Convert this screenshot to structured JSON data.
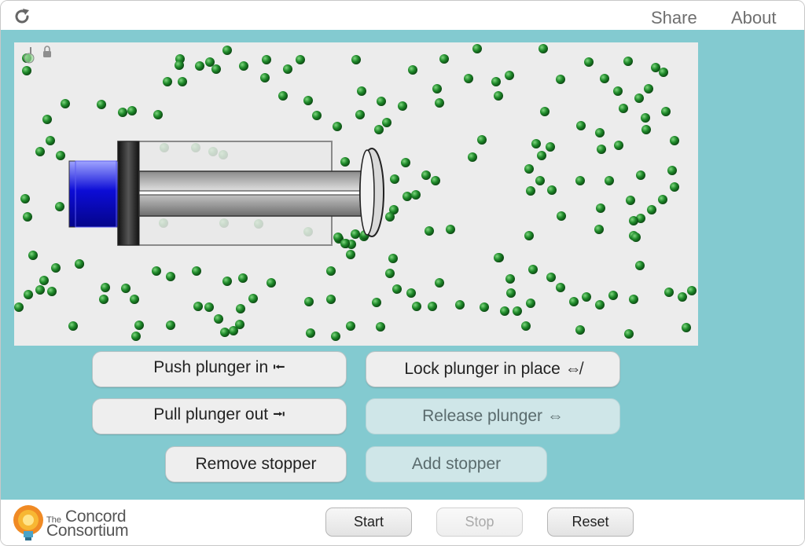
{
  "header": {
    "reload_icon": "reload-icon",
    "share_label": "Share",
    "about_label": "About"
  },
  "simulation": {
    "thermometer_icon": "thermometer-icon",
    "lock_icon": "lock-icon",
    "molecule_color": "#1f8a2a",
    "plunger_color": "#1a1adb",
    "background_color": "#ececec"
  },
  "buttons": {
    "push_in": "Push plunger in ⭰",
    "lock": "Lock plunger in place ⇎",
    "pull_out": "Pull plunger out ⭲",
    "release": "Release plunger ⇔",
    "remove_stopper": "Remove stopper",
    "add_stopper": "Add stopper"
  },
  "footer": {
    "logo_the": "The",
    "logo_concord": "Concord",
    "logo_consortium": "Consortium",
    "start_label": "Start",
    "stop_label": "Stop",
    "reset_label": "Reset"
  },
  "colors": {
    "panel_bg": "#83cad0",
    "button_bg": "#eeeeee",
    "button_disabled_bg": "#cfe6e8"
  }
}
